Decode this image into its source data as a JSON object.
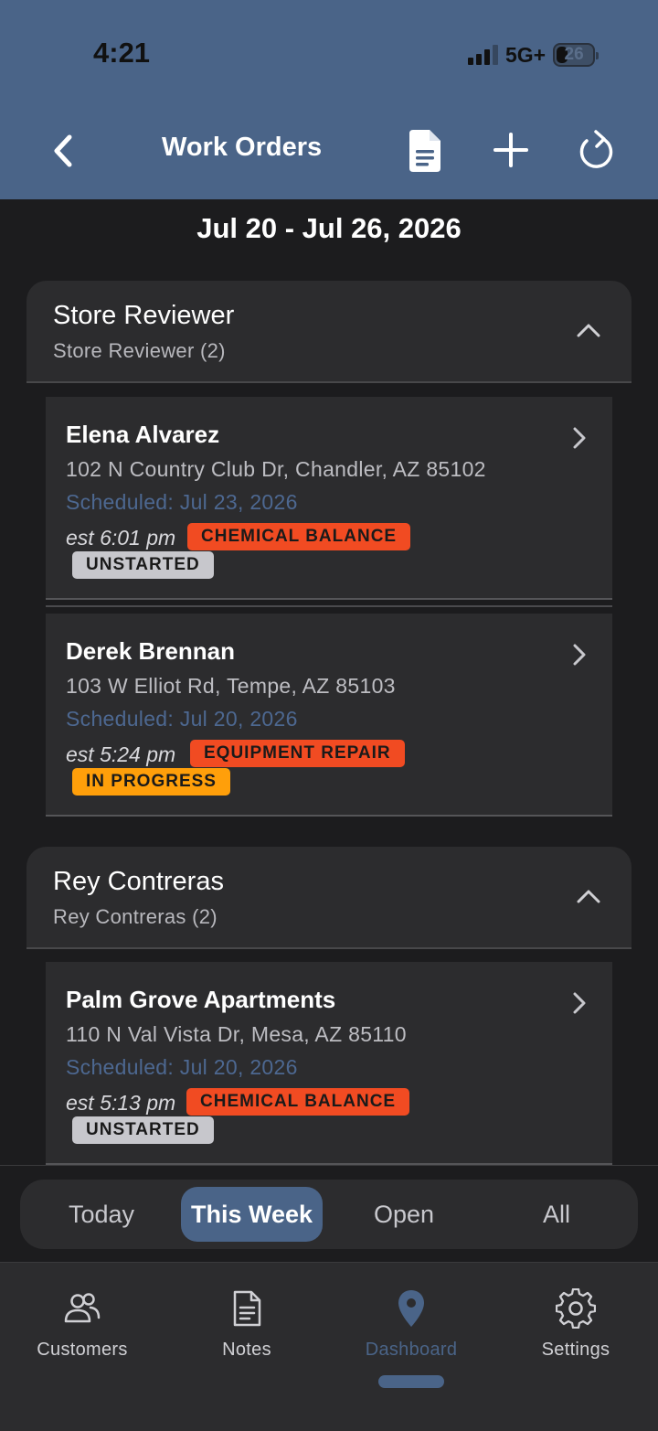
{
  "status_bar": {
    "time": "4:21",
    "network": "5G+",
    "battery": "26"
  },
  "nav": {
    "title": "Work Orders",
    "icons": [
      "back-chevron-icon",
      "document-icon",
      "plus-icon",
      "refresh-icon"
    ]
  },
  "week_range": "Jul 20 - Jul 26, 2026",
  "groups": [
    {
      "title": "Store Reviewer",
      "subtitle": "Store Reviewer (2)",
      "cards": [
        {
          "name": "Elena Alvarez",
          "address": "102 N Country Club Dr, Chandler, AZ 85102",
          "scheduled": "Scheduled: Jul 23, 2026",
          "est": "est 6:01 pm",
          "tag": "CHEMICAL BALANCE",
          "status": "UNSTARTED"
        },
        {
          "name": "Derek Brennan",
          "address": "103 W Elliot Rd, Tempe, AZ 85103",
          "scheduled": "Scheduled: Jul 20, 2026",
          "est": "est 5:24 pm",
          "tag": "EQUIPMENT REPAIR",
          "status": "IN PROGRESS"
        }
      ]
    },
    {
      "title": "Rey Contreras",
      "subtitle": "Rey Contreras (2)",
      "cards": [
        {
          "name": "Palm Grove Apartments",
          "address": "110 N Val Vista Dr, Mesa, AZ 85110",
          "scheduled": "Scheduled: Jul 20, 2026",
          "est": "est 5:13 pm",
          "tag": "CHEMICAL BALANCE",
          "status": "UNSTARTED"
        }
      ]
    }
  ],
  "filter_segments": [
    "Today",
    "This Week",
    "Open",
    "All"
  ],
  "filter_selected": "This Week",
  "tabs": [
    {
      "label": "Customers",
      "icon": "users-icon"
    },
    {
      "label": "Notes",
      "icon": "notes-icon"
    },
    {
      "label": "Dashboard",
      "icon": "location-pin-icon"
    },
    {
      "label": "Settings",
      "icon": "gear-icon"
    }
  ],
  "active_tab": "Dashboard",
  "colors": {
    "accent": "#4a6488",
    "tag": "#f14b22",
    "status_unstarted": "#c7c7cc",
    "status_in_progress": "#ff9f0a",
    "background": "#1c1c1e",
    "surface": "#2c2c2e"
  }
}
